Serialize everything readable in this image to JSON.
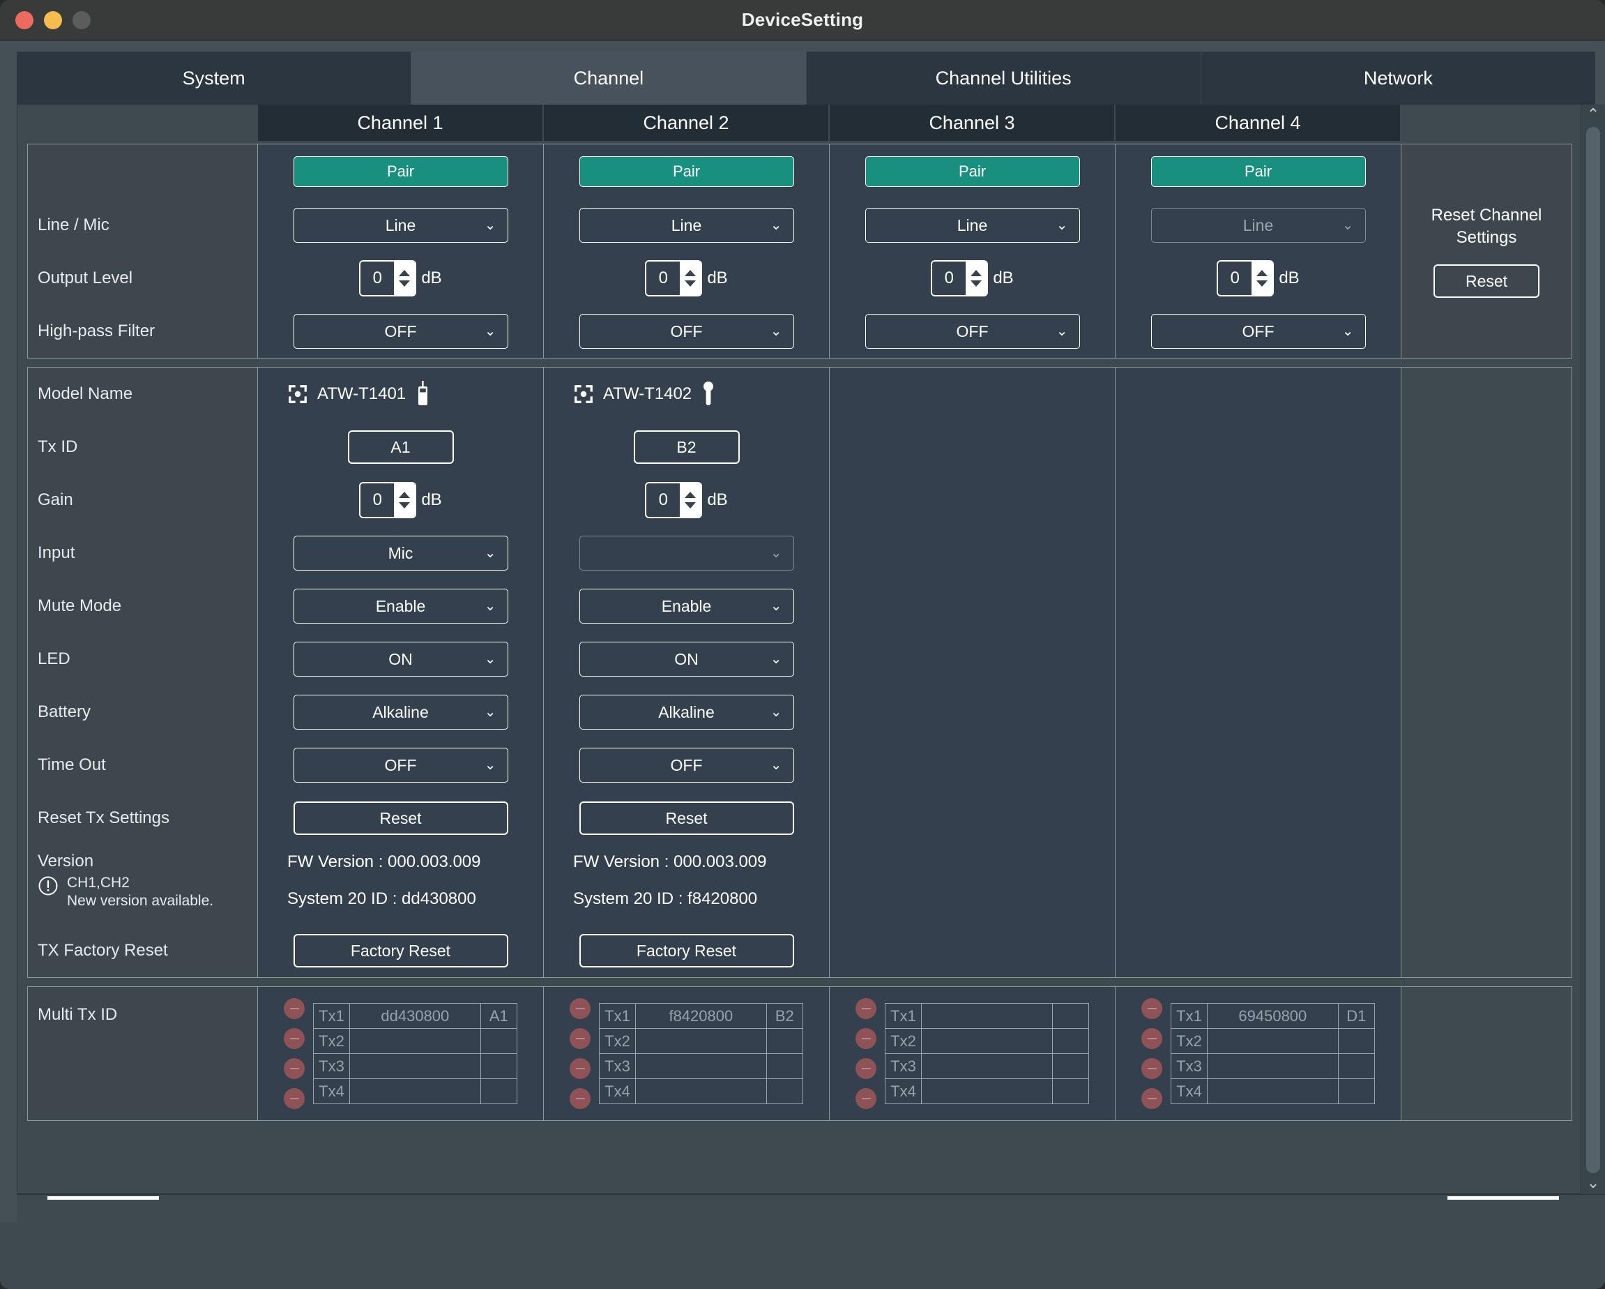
{
  "window": {
    "title": "DeviceSetting",
    "traffic_lights": [
      "close-red",
      "minimize-yellow",
      "zoom-gray"
    ],
    "accent_teal": "#19907f",
    "panel_bg": "#3f4a50",
    "column_bg": "#34404d",
    "label_bg": "#3e474d"
  },
  "tabs": [
    {
      "label": "System",
      "active": false
    },
    {
      "label": "Channel",
      "active": true
    },
    {
      "label": "Channel Utilities",
      "active": false
    },
    {
      "label": "Network",
      "active": false
    }
  ],
  "channel_headers": [
    "Channel 1",
    "Channel 2",
    "Channel 3",
    "Channel 4"
  ],
  "receiver_section": {
    "labels": {
      "line_mic": "Line / Mic",
      "output_level": "Output Level",
      "high_pass_filter": "High-pass Filter"
    },
    "reset_panel": {
      "title_line1": "Reset Channel",
      "title_line2": "Settings",
      "button": "Reset"
    },
    "channels": [
      {
        "pair": "Pair",
        "line_mic": "Line",
        "line_mic_disabled": false,
        "output_level": "0",
        "output_unit": "dB",
        "hpf": "OFF"
      },
      {
        "pair": "Pair",
        "line_mic": "Line",
        "line_mic_disabled": false,
        "output_level": "0",
        "output_unit": "dB",
        "hpf": "OFF"
      },
      {
        "pair": "Pair",
        "line_mic": "Line",
        "line_mic_disabled": false,
        "output_level": "0",
        "output_unit": "dB",
        "hpf": "OFF"
      },
      {
        "pair": "Pair",
        "line_mic": "Line",
        "line_mic_disabled": true,
        "output_level": "0",
        "output_unit": "dB",
        "hpf": "OFF"
      }
    ]
  },
  "transmitter_section": {
    "labels": {
      "model_name": "Model Name",
      "tx_id": "Tx ID",
      "gain": "Gain",
      "input": "Input",
      "mute_mode": "Mute Mode",
      "led": "LED",
      "battery": "Battery",
      "time_out": "Time Out",
      "reset_tx_settings": "Reset Tx Settings",
      "version": "Version",
      "tx_factory_reset": "TX Factory Reset"
    },
    "version_warning": {
      "channels": "CH1,CH2",
      "message": "New version available."
    },
    "channels": [
      {
        "model_name": "ATW-T1401",
        "device_icon": "bodypack-transmitter-icon",
        "tx_id": "A1",
        "gain": "0",
        "gain_unit": "dB",
        "input": "Mic",
        "input_disabled": false,
        "mute_mode": "Enable",
        "led": "ON",
        "battery": "Alkaline",
        "time_out": "OFF",
        "reset_button": "Reset",
        "fw_version": "FW Version : 000.003.009",
        "system_id": "System 20 ID : dd430800",
        "factory_reset_button": "Factory Reset"
      },
      {
        "model_name": "ATW-T1402",
        "device_icon": "handheld-microphone-icon",
        "tx_id": "B2",
        "gain": "0",
        "gain_unit": "dB",
        "input": "",
        "input_disabled": true,
        "mute_mode": "Enable",
        "led": "ON",
        "battery": "Alkaline",
        "time_out": "OFF",
        "reset_button": "Reset",
        "fw_version": "FW Version : 000.003.009",
        "system_id": "System 20 ID : f8420800",
        "factory_reset_button": "Factory Reset"
      },
      {
        "model_name": "",
        "device_icon": "",
        "tx_id": "",
        "gain": "",
        "gain_unit": "",
        "input": "",
        "mute_mode": "",
        "led": "",
        "battery": "",
        "time_out": "",
        "reset_button": "",
        "fw_version": "",
        "system_id": "",
        "factory_reset_button": ""
      },
      {
        "model_name": "",
        "device_icon": "",
        "tx_id": "",
        "gain": "",
        "gain_unit": "",
        "input": "",
        "mute_mode": "",
        "led": "",
        "battery": "",
        "time_out": "",
        "reset_button": "",
        "fw_version": "",
        "system_id": "",
        "factory_reset_button": ""
      }
    ]
  },
  "multi_tx": {
    "label": "Multi Tx ID",
    "row_labels": [
      "Tx1",
      "Tx2",
      "Tx3",
      "Tx4"
    ],
    "channels": [
      {
        "rows": [
          {
            "id": "dd430800",
            "code": "A1"
          },
          {
            "id": "",
            "code": ""
          },
          {
            "id": "",
            "code": ""
          },
          {
            "id": "",
            "code": ""
          }
        ]
      },
      {
        "rows": [
          {
            "id": "f8420800",
            "code": "B2"
          },
          {
            "id": "",
            "code": ""
          },
          {
            "id": "",
            "code": ""
          },
          {
            "id": "",
            "code": ""
          }
        ]
      },
      {
        "rows": [
          {
            "id": "",
            "code": ""
          },
          {
            "id": "",
            "code": ""
          },
          {
            "id": "",
            "code": ""
          },
          {
            "id": "",
            "code": ""
          }
        ]
      },
      {
        "rows": [
          {
            "id": "69450800",
            "code": "D1"
          },
          {
            "id": "",
            "code": ""
          },
          {
            "id": "",
            "code": ""
          },
          {
            "id": "",
            "code": ""
          }
        ]
      }
    ]
  },
  "scrollbars": {
    "vertical_up_arrow": "chevron-up-icon",
    "vertical_down_arrow": "chevron-down-icon"
  }
}
